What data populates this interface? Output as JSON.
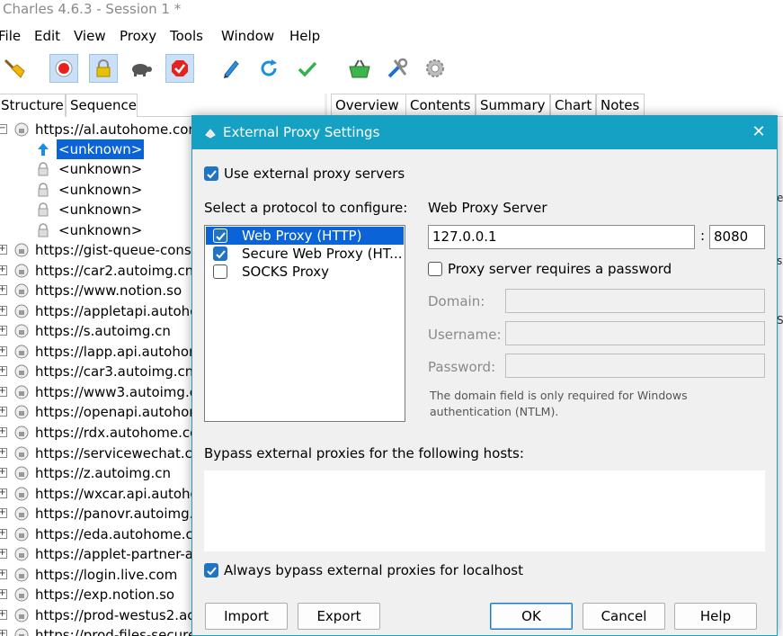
{
  "window": {
    "title": "Charles 4.6.3 - Session 1 *"
  },
  "menu": [
    "File",
    "Edit",
    "View",
    "Proxy",
    "Tools",
    "Window",
    "Help"
  ],
  "toolbar": {
    "icons": [
      "broom-icon",
      "record-icon",
      "ssl-lock-icon",
      "turtle-throttle-icon",
      "breakpoint-icon",
      "pen-compose-icon",
      "refresh-icon",
      "checkmark-validate-icon",
      "basket-icon",
      "tools-icon",
      "settings-gear-icon"
    ]
  },
  "left_tabs": [
    "Structure",
    "Sequence"
  ],
  "right_tabs": [
    "Overview",
    "Contents",
    "Summary",
    "Chart",
    "Notes"
  ],
  "tree": {
    "root": "https://al.autohome.com",
    "children": [
      "<unknown>",
      "<unknown>",
      "<unknown>",
      "<unknown>",
      "<unknown>"
    ],
    "hosts": [
      "https://gist-queue-cons",
      "https://car2.autoimg.cn",
      "https://www.notion.so",
      "https://appletapi.autoho",
      "https://s.autoimg.cn",
      "https://lapp.api.autohor",
      "https://car3.autoimg.cn",
      "https://www3.autoimg.c",
      "https://openapi.autohor",
      "https://rdx.autohome.co",
      "https://servicewechat.co",
      "https://z.autoimg.cn",
      "https://wxcar.api.autoho",
      "https://panovr.autoimg.",
      "https://eda.autohome.co",
      "https://applet-partner-a",
      "https://login.live.com",
      "https://exp.notion.so",
      "https://prod-westus2.ac",
      "https://prod-files-secure"
    ]
  },
  "right_fragments": [
    "e",
    "s",
    "S"
  ],
  "dialog": {
    "title": "External Proxy Settings",
    "use_external_label": "Use external proxy servers",
    "use_external_checked": true,
    "protocol_heading": "Select a protocol to configure:",
    "protocols": [
      {
        "label": "Web Proxy (HTTP)",
        "checked": true,
        "selected": true
      },
      {
        "label": "Secure Web Proxy (HT...",
        "checked": true,
        "selected": false
      },
      {
        "label": "SOCKS Proxy",
        "checked": false,
        "selected": false
      }
    ],
    "server_heading": "Web Proxy Server",
    "host": "127.0.0.1",
    "port_sep": ":",
    "port": "8080",
    "requires_password_label": "Proxy server requires a password",
    "requires_password_checked": false,
    "domain_label": "Domain:",
    "username_label": "Username:",
    "password_label": "Password:",
    "note_line1": "The domain field is only required for Windows",
    "note_line2": "authentication (NTLM).",
    "bypass_heading": "Bypass external proxies for the following hosts:",
    "bypass_hosts": "",
    "localhost_label": "Always bypass external proxies for localhost",
    "localhost_checked": true,
    "buttons": {
      "import": "Import",
      "export": "Export",
      "ok": "OK",
      "cancel": "Cancel",
      "help": "Help"
    }
  },
  "colors": {
    "dialog_title_bg": "#14a1c4",
    "selection": "#0a64d8",
    "checkbox": "#1f74c4"
  }
}
